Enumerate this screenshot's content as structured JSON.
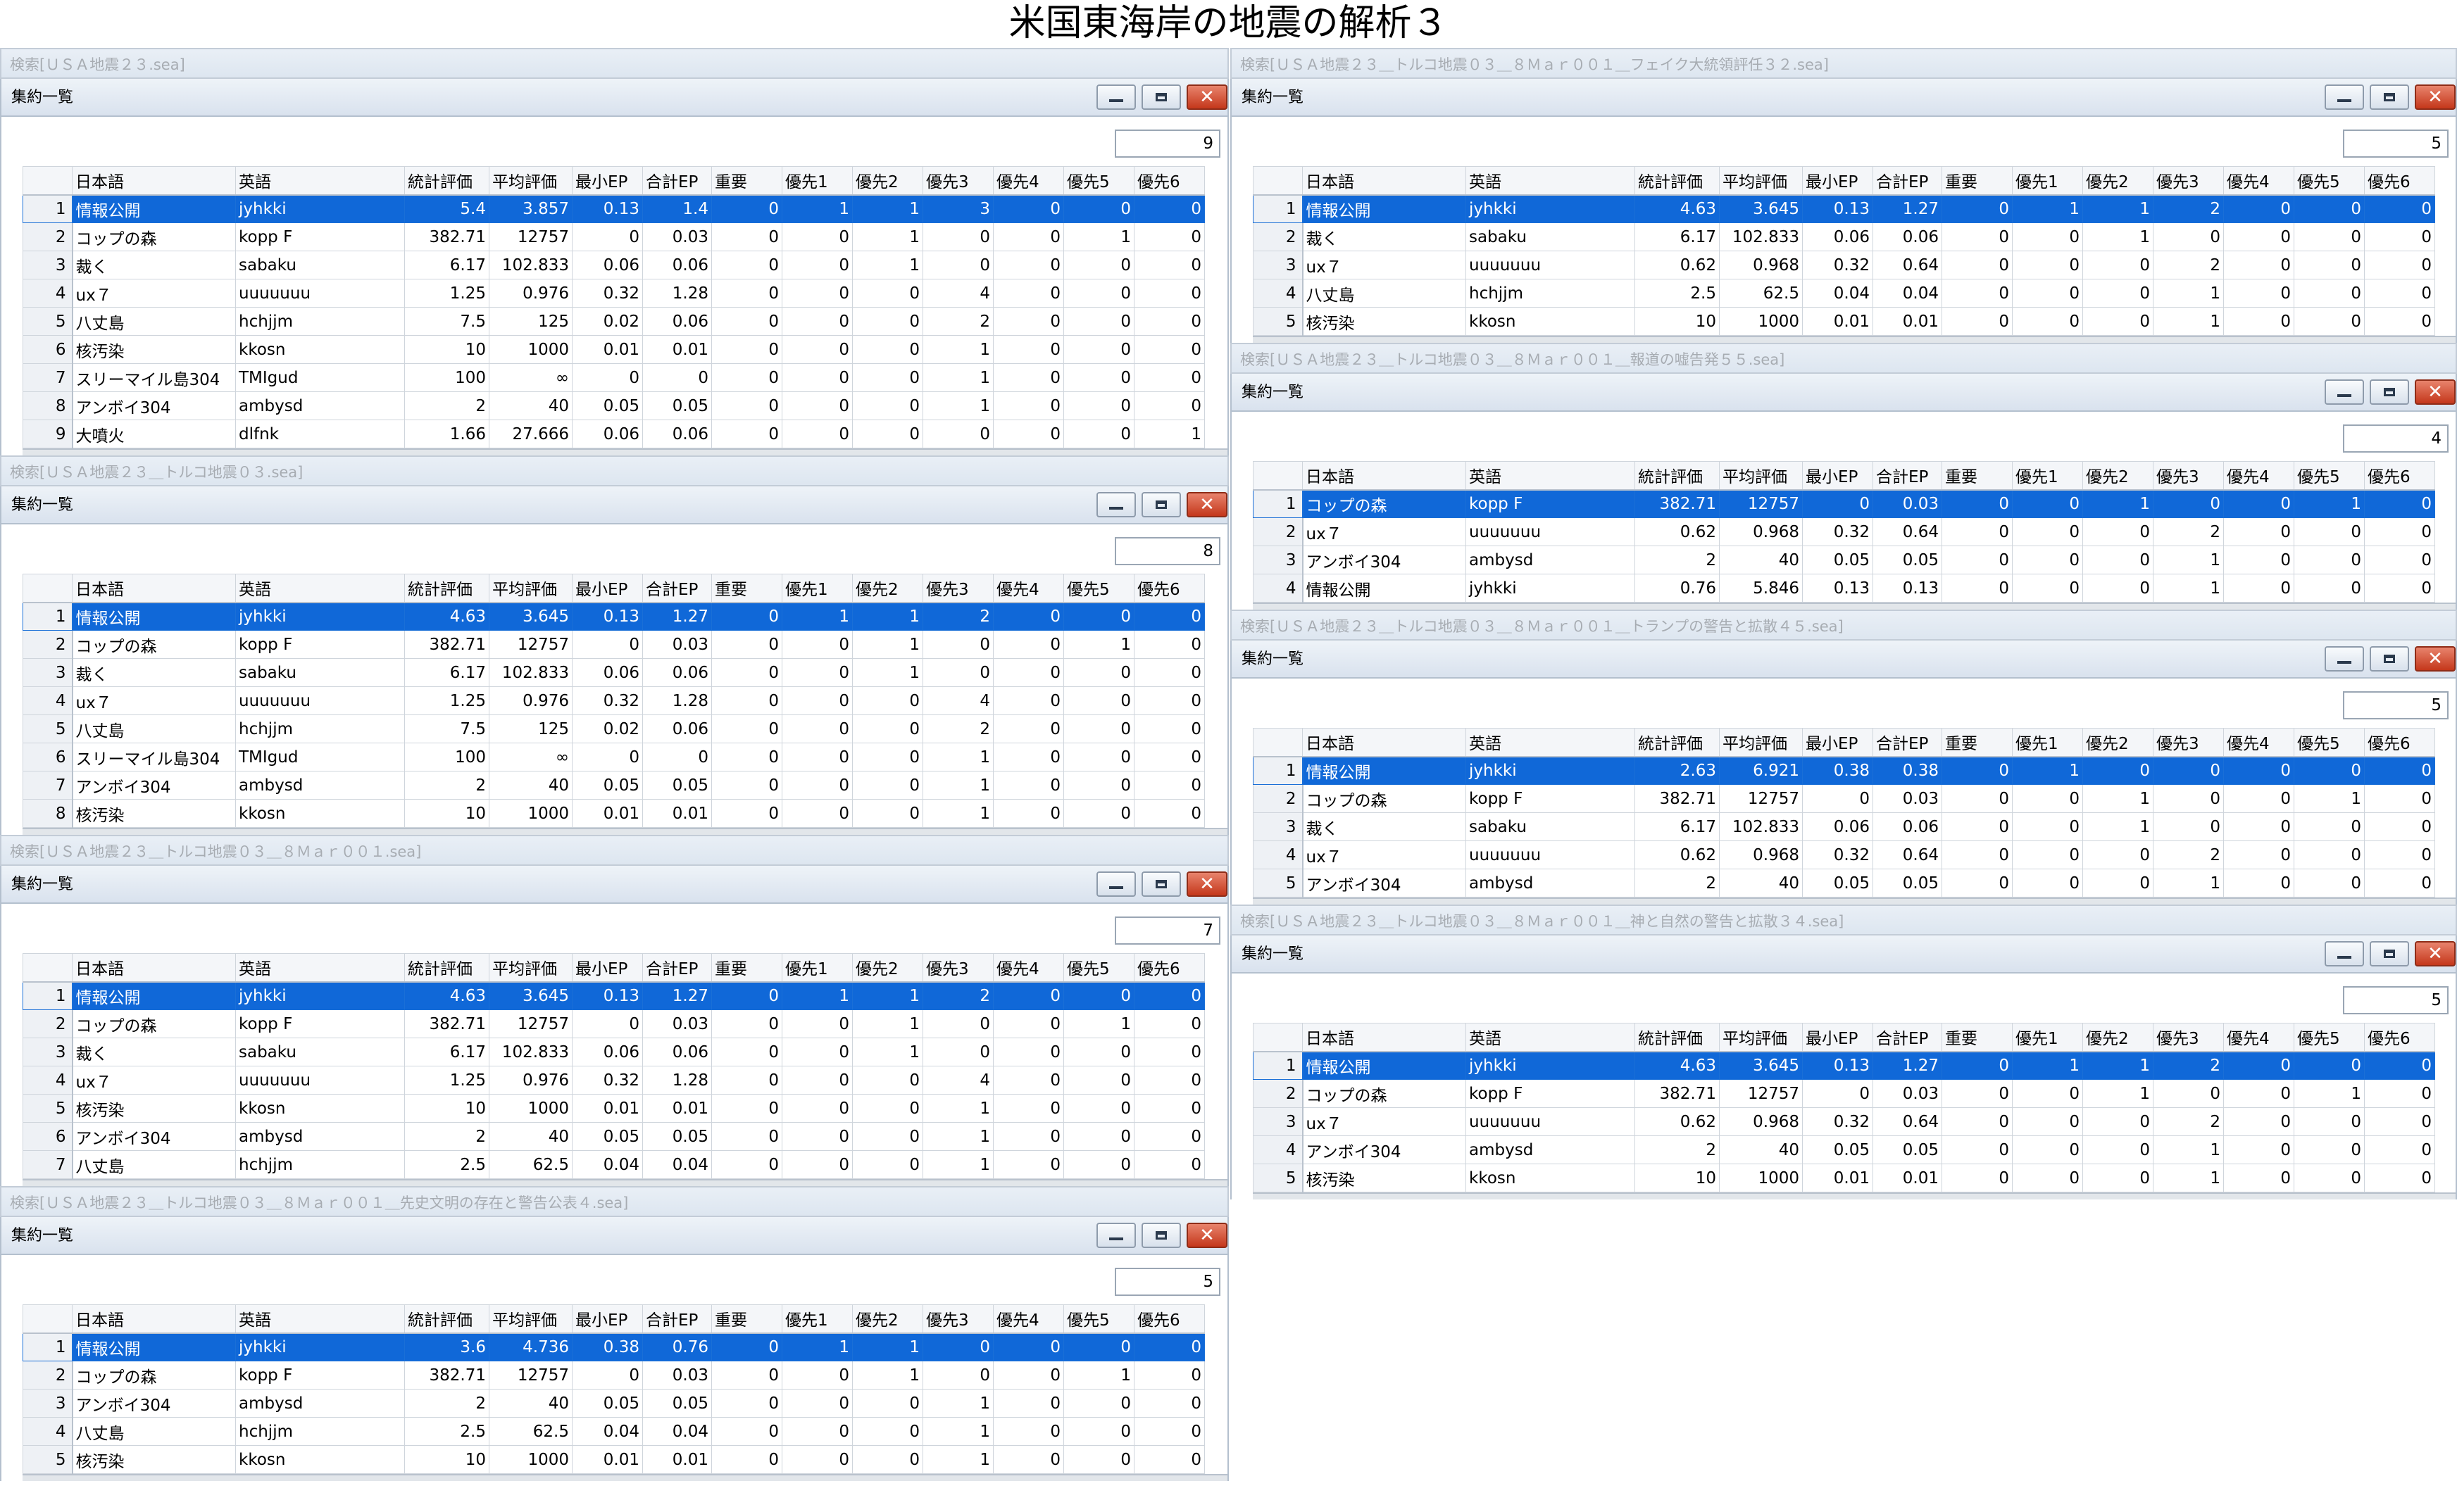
{
  "page_title": "米国東海岸の地震の解析３",
  "common": {
    "panel_title": "集約一覧",
    "columns": [
      "日本語",
      "英語",
      "統計評価",
      "平均評価",
      "最小EP",
      "合計EP",
      "重要",
      "優先1",
      "優先2",
      "優先3",
      "優先4",
      "優先5",
      "優先6"
    ]
  },
  "windows": [
    {
      "caption": "検索[ＵＳＡ地震２３.sea]",
      "count": "9",
      "rows": [
        [
          "1",
          "情報公開",
          "jyhkki",
          "5.4",
          "3.857",
          "0.13",
          "1.4",
          "0",
          "1",
          "1",
          "3",
          "0",
          "0",
          "0"
        ],
        [
          "2",
          "コップの森",
          "kopp F",
          "382.71",
          "12757",
          "0",
          "0.03",
          "0",
          "0",
          "1",
          "0",
          "0",
          "1",
          "0"
        ],
        [
          "3",
          "裁く",
          "sabaku",
          "6.17",
          "102.833",
          "0.06",
          "0.06",
          "0",
          "0",
          "1",
          "0",
          "0",
          "0",
          "0"
        ],
        [
          "4",
          "ux７",
          "uuuuuuu",
          "1.25",
          "0.976",
          "0.32",
          "1.28",
          "0",
          "0",
          "0",
          "4",
          "0",
          "0",
          "0"
        ],
        [
          "5",
          "八丈島",
          "hchjjm",
          "7.5",
          "125",
          "0.02",
          "0.06",
          "0",
          "0",
          "0",
          "2",
          "0",
          "0",
          "0"
        ],
        [
          "6",
          "核汚染",
          "kkosn",
          "10",
          "1000",
          "0.01",
          "0.01",
          "0",
          "0",
          "0",
          "1",
          "0",
          "0",
          "0"
        ],
        [
          "7",
          "スリーマイル島304",
          "TMIgud",
          "100",
          "∞",
          "0",
          "0",
          "0",
          "0",
          "0",
          "1",
          "0",
          "0",
          "0"
        ],
        [
          "8",
          "アンボイ304",
          "ambysd",
          "2",
          "40",
          "0.05",
          "0.05",
          "0",
          "0",
          "0",
          "1",
          "0",
          "0",
          "0"
        ],
        [
          "9",
          "大噴火",
          "dlfnk",
          "1.66",
          "27.666",
          "0.06",
          "0.06",
          "0",
          "0",
          "0",
          "0",
          "0",
          "0",
          "1"
        ]
      ]
    },
    {
      "caption": "検索[ＵＳＡ地震２３＿トルコ地震０３.sea]",
      "count": "8",
      "rows": [
        [
          "1",
          "情報公開",
          "jyhkki",
          "4.63",
          "3.645",
          "0.13",
          "1.27",
          "0",
          "1",
          "1",
          "2",
          "0",
          "0",
          "0"
        ],
        [
          "2",
          "コップの森",
          "kopp F",
          "382.71",
          "12757",
          "0",
          "0.03",
          "0",
          "0",
          "1",
          "0",
          "0",
          "1",
          "0"
        ],
        [
          "3",
          "裁く",
          "sabaku",
          "6.17",
          "102.833",
          "0.06",
          "0.06",
          "0",
          "0",
          "1",
          "0",
          "0",
          "0",
          "0"
        ],
        [
          "4",
          "ux７",
          "uuuuuuu",
          "1.25",
          "0.976",
          "0.32",
          "1.28",
          "0",
          "0",
          "0",
          "4",
          "0",
          "0",
          "0"
        ],
        [
          "5",
          "八丈島",
          "hchjjm",
          "7.5",
          "125",
          "0.02",
          "0.06",
          "0",
          "0",
          "0",
          "2",
          "0",
          "0",
          "0"
        ],
        [
          "6",
          "スリーマイル島304",
          "TMIgud",
          "100",
          "∞",
          "0",
          "0",
          "0",
          "0",
          "0",
          "1",
          "0",
          "0",
          "0"
        ],
        [
          "7",
          "アンボイ304",
          "ambysd",
          "2",
          "40",
          "0.05",
          "0.05",
          "0",
          "0",
          "0",
          "1",
          "0",
          "0",
          "0"
        ],
        [
          "8",
          "核汚染",
          "kkosn",
          "10",
          "1000",
          "0.01",
          "0.01",
          "0",
          "0",
          "0",
          "1",
          "0",
          "0",
          "0"
        ]
      ]
    },
    {
      "caption": "検索[ＵＳＡ地震２３＿トルコ地震０３＿８Ｍａｒ００１.sea]",
      "count": "7",
      "rows": [
        [
          "1",
          "情報公開",
          "jyhkki",
          "4.63",
          "3.645",
          "0.13",
          "1.27",
          "0",
          "1",
          "1",
          "2",
          "0",
          "0",
          "0"
        ],
        [
          "2",
          "コップの森",
          "kopp F",
          "382.71",
          "12757",
          "0",
          "0.03",
          "0",
          "0",
          "1",
          "0",
          "0",
          "1",
          "0"
        ],
        [
          "3",
          "裁く",
          "sabaku",
          "6.17",
          "102.833",
          "0.06",
          "0.06",
          "0",
          "0",
          "1",
          "0",
          "0",
          "0",
          "0"
        ],
        [
          "4",
          "ux７",
          "uuuuuuu",
          "1.25",
          "0.976",
          "0.32",
          "1.28",
          "0",
          "0",
          "0",
          "4",
          "0",
          "0",
          "0"
        ],
        [
          "5",
          "核汚染",
          "kkosn",
          "10",
          "1000",
          "0.01",
          "0.01",
          "0",
          "0",
          "0",
          "1",
          "0",
          "0",
          "0"
        ],
        [
          "6",
          "アンボイ304",
          "ambysd",
          "2",
          "40",
          "0.05",
          "0.05",
          "0",
          "0",
          "0",
          "1",
          "0",
          "0",
          "0"
        ],
        [
          "7",
          "八丈島",
          "hchjjm",
          "2.5",
          "62.5",
          "0.04",
          "0.04",
          "0",
          "0",
          "0",
          "1",
          "0",
          "0",
          "0"
        ]
      ]
    },
    {
      "caption": "検索[ＵＳＡ地震２３＿トルコ地震０３＿８Ｍａｒ００１＿先史文明の存在と警告公表４.sea]",
      "count": "5",
      "rows": [
        [
          "1",
          "情報公開",
          "jyhkki",
          "3.6",
          "4.736",
          "0.38",
          "0.76",
          "0",
          "1",
          "1",
          "0",
          "0",
          "0",
          "0"
        ],
        [
          "2",
          "コップの森",
          "kopp F",
          "382.71",
          "12757",
          "0",
          "0.03",
          "0",
          "0",
          "1",
          "0",
          "0",
          "1",
          "0"
        ],
        [
          "3",
          "アンボイ304",
          "ambysd",
          "2",
          "40",
          "0.05",
          "0.05",
          "0",
          "0",
          "0",
          "1",
          "0",
          "0",
          "0"
        ],
        [
          "4",
          "八丈島",
          "hchjjm",
          "2.5",
          "62.5",
          "0.04",
          "0.04",
          "0",
          "0",
          "0",
          "1",
          "0",
          "0",
          "0"
        ],
        [
          "5",
          "核汚染",
          "kkosn",
          "10",
          "1000",
          "0.01",
          "0.01",
          "0",
          "0",
          "0",
          "1",
          "0",
          "0",
          "0"
        ]
      ]
    },
    {
      "caption": "検索[ＵＳＡ地震２３＿トルコ地震０３＿８Ｍａｒ００１＿フェイク大統領評任３２.sea]",
      "count": "5",
      "rows": [
        [
          "1",
          "情報公開",
          "jyhkki",
          "4.63",
          "3.645",
          "0.13",
          "1.27",
          "0",
          "1",
          "1",
          "2",
          "0",
          "0",
          "0"
        ],
        [
          "2",
          "裁く",
          "sabaku",
          "6.17",
          "102.833",
          "0.06",
          "0.06",
          "0",
          "0",
          "1",
          "0",
          "0",
          "0",
          "0"
        ],
        [
          "3",
          "ux７",
          "uuuuuuu",
          "0.62",
          "0.968",
          "0.32",
          "0.64",
          "0",
          "0",
          "0",
          "2",
          "0",
          "0",
          "0"
        ],
        [
          "4",
          "八丈島",
          "hchjjm",
          "2.5",
          "62.5",
          "0.04",
          "0.04",
          "0",
          "0",
          "0",
          "1",
          "0",
          "0",
          "0"
        ],
        [
          "5",
          "核汚染",
          "kkosn",
          "10",
          "1000",
          "0.01",
          "0.01",
          "0",
          "0",
          "0",
          "1",
          "0",
          "0",
          "0"
        ]
      ]
    },
    {
      "caption": "検索[ＵＳＡ地震２３＿トルコ地震０３＿８Ｍａｒ００１＿報道の嘘告発５５.sea]",
      "count": "4",
      "rows": [
        [
          "1",
          "コップの森",
          "kopp F",
          "382.71",
          "12757",
          "0",
          "0.03",
          "0",
          "0",
          "1",
          "0",
          "0",
          "1",
          "0"
        ],
        [
          "2",
          "ux７",
          "uuuuuuu",
          "0.62",
          "0.968",
          "0.32",
          "0.64",
          "0",
          "0",
          "0",
          "2",
          "0",
          "0",
          "0"
        ],
        [
          "3",
          "アンボイ304",
          "ambysd",
          "2",
          "40",
          "0.05",
          "0.05",
          "0",
          "0",
          "0",
          "1",
          "0",
          "0",
          "0"
        ],
        [
          "4",
          "情報公開",
          "jyhkki",
          "0.76",
          "5.846",
          "0.13",
          "0.13",
          "0",
          "0",
          "0",
          "1",
          "0",
          "0",
          "0"
        ]
      ]
    },
    {
      "caption": "検索[ＵＳＡ地震２３＿トルコ地震０３＿８Ｍａｒ００１＿トランプの警告と拡散４５.sea]",
      "count": "5",
      "rows": [
        [
          "1",
          "情報公開",
          "jyhkki",
          "2.63",
          "6.921",
          "0.38",
          "0.38",
          "0",
          "1",
          "0",
          "0",
          "0",
          "0",
          "0"
        ],
        [
          "2",
          "コップの森",
          "kopp F",
          "382.71",
          "12757",
          "0",
          "0.03",
          "0",
          "0",
          "1",
          "0",
          "0",
          "1",
          "0"
        ],
        [
          "3",
          "裁く",
          "sabaku",
          "6.17",
          "102.833",
          "0.06",
          "0.06",
          "0",
          "0",
          "1",
          "0",
          "0",
          "0",
          "0"
        ],
        [
          "4",
          "ux７",
          "uuuuuuu",
          "0.62",
          "0.968",
          "0.32",
          "0.64",
          "0",
          "0",
          "0",
          "2",
          "0",
          "0",
          "0"
        ],
        [
          "5",
          "アンボイ304",
          "ambysd",
          "2",
          "40",
          "0.05",
          "0.05",
          "0",
          "0",
          "0",
          "1",
          "0",
          "0",
          "0"
        ]
      ]
    },
    {
      "caption": "検索[ＵＳＡ地震２３＿トルコ地震０３＿８Ｍａｒ００１＿神と自然の警告と拡散３４.sea]",
      "count": "5",
      "rows": [
        [
          "1",
          "情報公開",
          "jyhkki",
          "4.63",
          "3.645",
          "0.13",
          "1.27",
          "0",
          "1",
          "1",
          "2",
          "0",
          "0",
          "0"
        ],
        [
          "2",
          "コップの森",
          "kopp F",
          "382.71",
          "12757",
          "0",
          "0.03",
          "0",
          "0",
          "1",
          "0",
          "0",
          "1",
          "0"
        ],
        [
          "3",
          "ux７",
          "uuuuuuu",
          "0.62",
          "0.968",
          "0.32",
          "0.64",
          "0",
          "0",
          "0",
          "2",
          "0",
          "0",
          "0"
        ],
        [
          "4",
          "アンボイ304",
          "ambysd",
          "2",
          "40",
          "0.05",
          "0.05",
          "0",
          "0",
          "0",
          "1",
          "0",
          "0",
          "0"
        ],
        [
          "5",
          "核汚染",
          "kkosn",
          "10",
          "1000",
          "0.01",
          "0.01",
          "0",
          "0",
          "0",
          "1",
          "0",
          "0",
          "0"
        ]
      ]
    }
  ]
}
